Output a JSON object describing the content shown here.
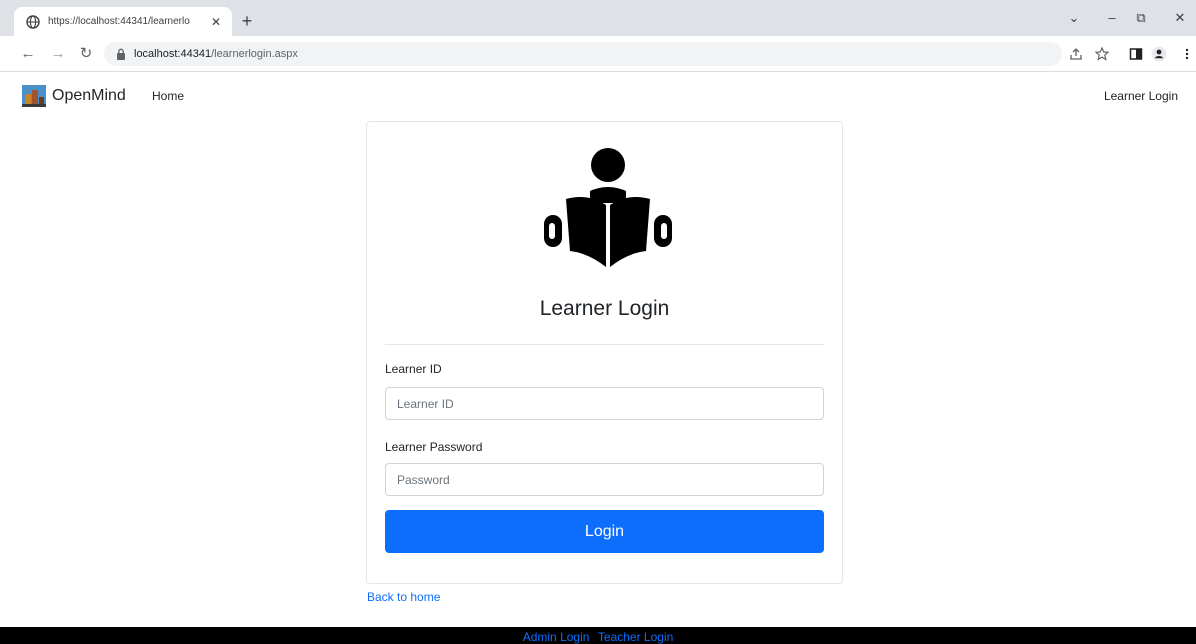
{
  "browser": {
    "tab_title": "https://localhost:44341/learnerlo",
    "tab_close": "✕",
    "new_tab": "+",
    "url_host": "localhost:44341",
    "url_path": "/learnerlogin.aspx",
    "icons": [
      "globe-icon",
      "back-icon",
      "forward-icon",
      "reload-icon",
      "lock-icon",
      "share-icon",
      "star-icon",
      "sidepanel-icon",
      "profile-icon",
      "menu-icon"
    ]
  },
  "navbar": {
    "brand": "OpenMind",
    "home": "Home",
    "right_link": "Learner Login"
  },
  "login": {
    "title": "Learner Login",
    "id_label": "Learner ID",
    "id_placeholder": "Learner ID",
    "password_label": "Learner Password",
    "password_placeholder": "Password",
    "button": "Login"
  },
  "back_link": "Back to home",
  "footer": {
    "admin": "Admin Login",
    "teacher": "Teacher Login"
  },
  "colors": {
    "primary": "#0d6efd",
    "footer_bg": "#000000",
    "chrome_bg": "#dee1e6"
  }
}
